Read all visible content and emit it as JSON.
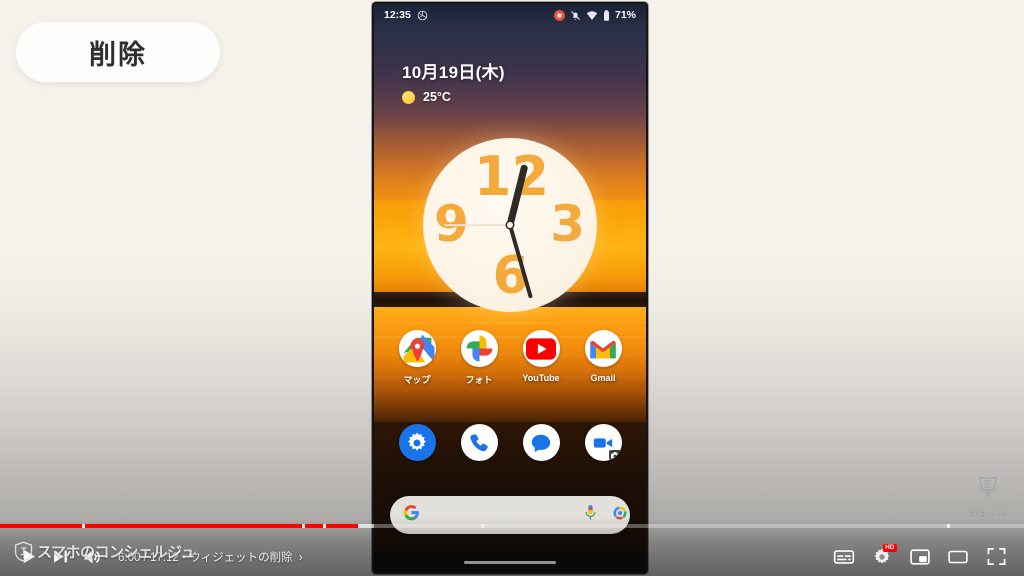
{
  "slide": {
    "caption_pill": "削除"
  },
  "phone": {
    "status_bar": {
      "time": "12:35",
      "left_icons": [
        "photos-icon"
      ],
      "right": {
        "recording_icon": "screen-record-icon",
        "mute_icon": "notifications-off-icon",
        "wifi_icon": "wifi-icon",
        "battery_icon": "battery-icon",
        "battery_text": "71%"
      }
    },
    "date_widget": {
      "date": "10月19日(木)",
      "weather_icon": "sun-icon",
      "temperature": "25°C"
    },
    "clock_widget": {
      "numerals": [
        "12",
        "3",
        "6",
        "9"
      ],
      "displayed_time": "12:35"
    },
    "app_row": [
      {
        "label": "マップ",
        "icon": "google-maps-icon"
      },
      {
        "label": "フォト",
        "icon": "google-photos-icon"
      },
      {
        "label": "YouTube",
        "icon": "youtube-icon"
      },
      {
        "label": "Gmail",
        "icon": "gmail-icon"
      }
    ],
    "dock_row": [
      {
        "label": "",
        "icon": "settings-gear-icon"
      },
      {
        "label": "",
        "icon": "phone-icon"
      },
      {
        "label": "",
        "icon": "messages-icon"
      },
      {
        "label": "",
        "icon": "meet-video-icon"
      }
    ],
    "search_bar": {
      "logo_icon": "google-g-icon",
      "mic_icon": "microphone-icon",
      "lens_icon": "google-lens-icon",
      "value": "",
      "placeholder": ""
    },
    "nav_bar": {
      "gesture_pill": "home-gesture-pill"
    },
    "drag_cursor": "drag-arrow-cursor"
  },
  "player": {
    "progress": {
      "played_percent": 35.0,
      "buffered_percent": 36.5,
      "chapter_marker_percents": [
        8.0,
        29.5,
        31.5,
        47.0,
        92.5
      ]
    },
    "controls": {
      "play_icon": "play-icon",
      "next_icon": "next-track-icon",
      "volume_icon": "volume-on-icon",
      "time": "6:00 / 17:12",
      "separator": "•",
      "chapter": "ウィジェットの削除",
      "chapter_chevron": "chevron-right-icon",
      "subtitles_icon": "subtitles-icon",
      "settings_icon": "settings-gear-icon",
      "quality_badge": "HD",
      "miniplayer_icon": "miniplayer-icon",
      "theater_icon": "theater-mode-icon",
      "fullscreen_icon": "fullscreen-icon"
    },
    "channel_watermark": {
      "logo_icon": "shield-logo-icon",
      "text": "スマホのコンシェルジュ"
    },
    "corner_watermark": {
      "logo_icon": "core-concier-logo-icon",
      "text": "コアコンシェル"
    }
  },
  "colors": {
    "progress_red": "#ff0000",
    "hd_badge_red": "#ff0000",
    "stage_bg": "#f4f0ea",
    "pill_bg": "#fdfdfb"
  }
}
